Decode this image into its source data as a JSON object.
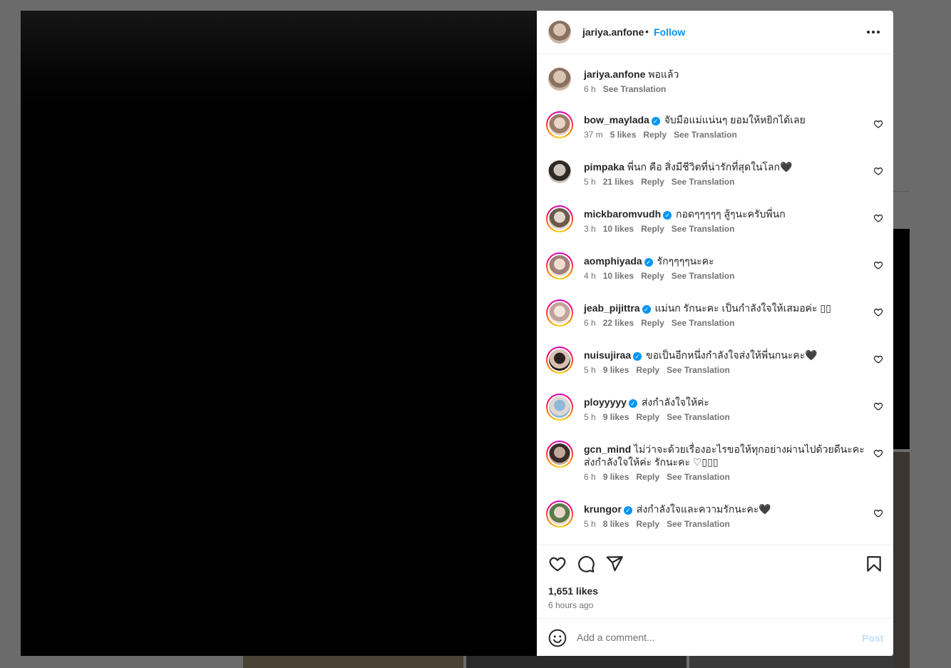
{
  "post": {
    "author": "jariya.anfone",
    "separator": "•",
    "follow_label": "Follow",
    "caption": {
      "user": "jariya.anfone",
      "text": "พอแล้ว",
      "time": "6 h",
      "see_translation": "See Translation"
    },
    "likes": "1,651 likes",
    "time_ago": "6 hours ago"
  },
  "comments": [
    {
      "user": "bow_maylada",
      "verified": true,
      "text": "จับมือแม่แน่นๆ ยอมให้หยิกได้เลย",
      "time": "37 m",
      "likes": "5 likes",
      "reply": "Reply",
      "see_translation": "See Translation"
    },
    {
      "user": "pimpaka",
      "verified": false,
      "text": "พี่นก คือ สิ่งมีชีวิตที่น่ารักที่สุดในโลก🖤",
      "time": "5 h",
      "likes": "21 likes",
      "reply": "Reply",
      "see_translation": "See Translation"
    },
    {
      "user": "mickbaromvudh",
      "verified": true,
      "text": "กอดๆๆๆๆๆ สู้ๆนะครับพี่นก",
      "time": "3 h",
      "likes": "10 likes",
      "reply": "Reply",
      "see_translation": "See Translation"
    },
    {
      "user": "aomphiyada",
      "verified": true,
      "text": "รักๆๆๆๆนะคะ",
      "time": "4 h",
      "likes": "10 likes",
      "reply": "Reply",
      "see_translation": "See Translation"
    },
    {
      "user": "jeab_pijittra",
      "verified": true,
      "text": "แม่นก รักนะคะ เป็นกำลังใจให้เสมอค่ะ ▯▯",
      "time": "6 h",
      "likes": "22 likes",
      "reply": "Reply",
      "see_translation": "See Translation"
    },
    {
      "user": "nuisujiraa",
      "verified": true,
      "text": "ขอเป็นอีกหนึ่งกำลังใจส่งให้พี่นกนะคะ🖤",
      "time": "5 h",
      "likes": "9 likes",
      "reply": "Reply",
      "see_translation": "See Translation"
    },
    {
      "user": "ployyyyy",
      "verified": true,
      "text": "ส่งกำลังใจให้ค่ะ",
      "time": "5 h",
      "likes": "9 likes",
      "reply": "Reply",
      "see_translation": "See Translation"
    },
    {
      "user": "gcn_mind",
      "verified": false,
      "text": "ไม่ว่าจะด้วยเรื่องอะไรขอให้ทุกอย่างผ่านไปด้วยดีนะคะ ส่งกำลังใจให้ค่ะ รักนะคะ ♡▯▯▯",
      "time": "6 h",
      "likes": "9 likes",
      "reply": "Reply",
      "see_translation": "See Translation"
    },
    {
      "user": "krungor",
      "verified": true,
      "text": "ส่งกำลังใจและความรักนะคะ🖤",
      "time": "5 h",
      "likes": "8 likes",
      "reply": "Reply",
      "see_translation": "See Translation"
    }
  ],
  "composer": {
    "placeholder": "Add a comment...",
    "post_label": "Post"
  },
  "icons": {
    "verified": "✓"
  },
  "colors": {
    "accent": "#0095f6",
    "muted_text": "#737373",
    "backdrop": "#6b6b6b"
  }
}
